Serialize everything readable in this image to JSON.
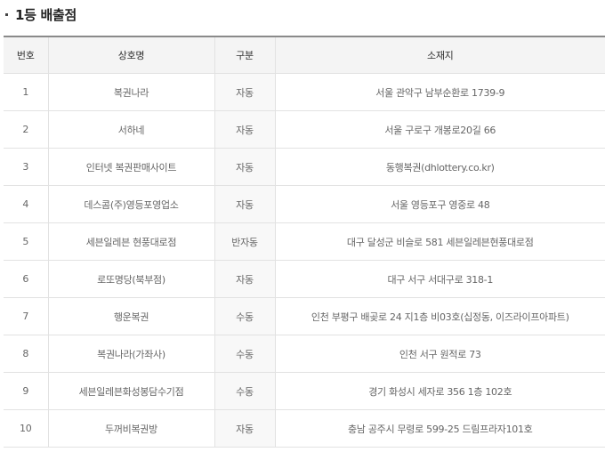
{
  "heading": {
    "title": "1등 배출점"
  },
  "table": {
    "headers": {
      "no": "번호",
      "name": "상호명",
      "type": "구분",
      "address": "소재지"
    },
    "rows": [
      {
        "no": "1",
        "name": "복권나라",
        "type": "자동",
        "address": "서울 관악구 남부순환로 1739-9"
      },
      {
        "no": "2",
        "name": "서하네",
        "type": "자동",
        "address": "서울 구로구 개봉로20길 66"
      },
      {
        "no": "3",
        "name": "인터넷 복권판매사이트",
        "type": "자동",
        "address": "동행복권(dhlottery.co.kr)"
      },
      {
        "no": "4",
        "name": "데스콤(주)영등포영업소",
        "type": "자동",
        "address": "서울 영등포구 영중로 48"
      },
      {
        "no": "5",
        "name": "세븐일레븐 현풍대로점",
        "type": "반자동",
        "address": "대구 달성군 비슬로 581 세븐일레븐현풍대로점"
      },
      {
        "no": "6",
        "name": "로또명당(북부점)",
        "type": "자동",
        "address": "대구 서구 서대구로 318-1"
      },
      {
        "no": "7",
        "name": "행운복권",
        "type": "수동",
        "address": "인천 부평구 배곶로 24 지1층 비03호(십정동, 이즈라이프아파트)"
      },
      {
        "no": "8",
        "name": "복권나라(가좌사)",
        "type": "수동",
        "address": "인천 서구 원적로 73"
      },
      {
        "no": "9",
        "name": "세븐일레븐화성봉담수기점",
        "type": "수동",
        "address": "경기 화성시 세자로 356 1층 102호"
      },
      {
        "no": "10",
        "name": "두꺼비복권방",
        "type": "자동",
        "address": "충남 공주시 무령로 599-25 드림프라자101호"
      }
    ]
  }
}
